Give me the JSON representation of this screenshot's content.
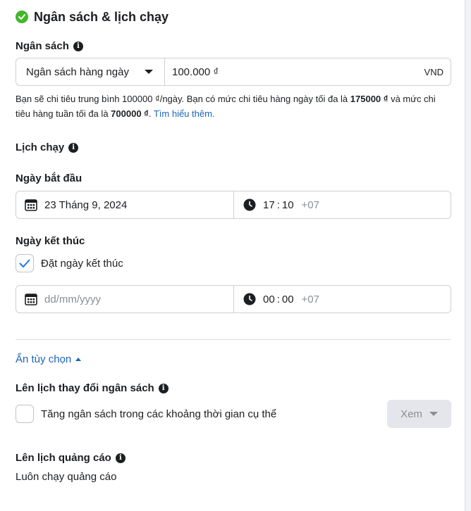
{
  "section": {
    "title": "Ngân sách & lịch chạy"
  },
  "budget": {
    "label": "Ngân sách",
    "type_value": "Ngân sách hàng ngày",
    "amount_value": "100.000 ₫",
    "currency": "VND",
    "help_part1": "Bạn sẽ chi tiêu trung bình 100000 ₫/ngày. Bạn có mức chi tiêu hàng ngày tối đa là ",
    "help_bold1": "175000 ₫",
    "help_part2": " và mức chi tiêu hàng tuần tối đa là ",
    "help_bold2": "700000 ₫",
    "help_part3": ". ",
    "help_link": "Tìm hiểu thêm."
  },
  "schedule": {
    "label": "Lịch chạy",
    "start": {
      "label": "Ngày bắt đầu",
      "date_value": "23 Tháng 9, 2024",
      "time_hour": "17",
      "time_sep": ":",
      "time_minute": "10",
      "tz": "+07"
    },
    "end": {
      "label": "Ngày kết thúc",
      "checkbox_label": "Đặt ngày kết thúc",
      "checkbox_checked": true,
      "date_placeholder": "dd/mm/yyyy",
      "time_hour": "00",
      "time_sep": ":",
      "time_minute": "00",
      "tz": "+07"
    }
  },
  "options": {
    "toggle_label": "Ẩn tùy chọn",
    "budget_change": {
      "label": "Lên lịch thay đổi ngân sách",
      "checkbox_label": "Tăng ngân sách trong các khoảng thời gian cụ thể",
      "view_button": "Xem"
    },
    "ad_schedule": {
      "label": "Lên lịch quảng cáo",
      "value": "Luôn chạy quảng cáo"
    }
  },
  "colors": {
    "success": "#42b72a",
    "link": "#1d65b5",
    "checkbox_accent": "#1877f2"
  }
}
